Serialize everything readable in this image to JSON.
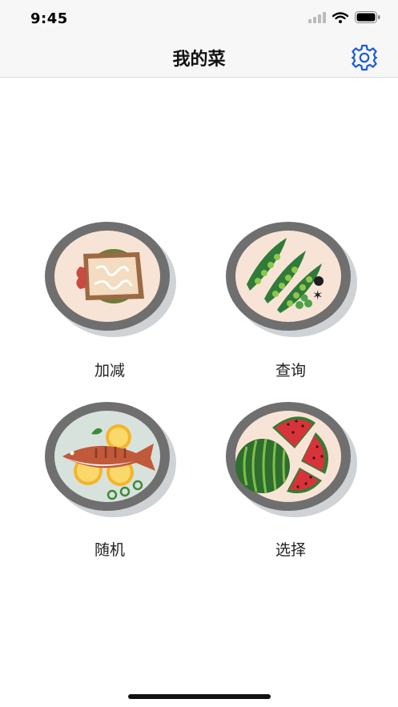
{
  "status_bar": {
    "time": "9:45",
    "icons": [
      "signal-icon",
      "wifi-icon",
      "battery-icon"
    ]
  },
  "nav": {
    "title": "我的菜",
    "settings_icon": "gear-icon",
    "accent_color": "#1a5ad8"
  },
  "menu": {
    "items": [
      {
        "label": "加减",
        "icon": "sandwich-plate-icon"
      },
      {
        "label": "查询",
        "icon": "peas-plate-icon"
      },
      {
        "label": "随机",
        "icon": "fish-plate-icon"
      },
      {
        "label": "选择",
        "icon": "watermelon-plate-icon"
      }
    ]
  }
}
